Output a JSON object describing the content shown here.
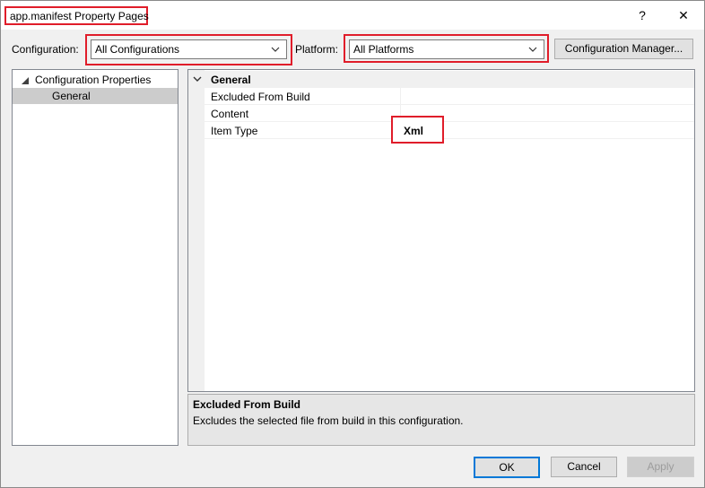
{
  "window": {
    "title": "app.manifest Property Pages",
    "help_glyph": "?",
    "close_glyph": "✕"
  },
  "toolbar": {
    "configuration_label": "Configuration:",
    "configuration_value": "All Configurations",
    "platform_label": "Platform:",
    "platform_value": "All Platforms",
    "config_manager_label": "Configuration Manager..."
  },
  "tree": {
    "root_label": "Configuration Properties",
    "child_label": "General"
  },
  "grid": {
    "section_title": "General",
    "rows": [
      {
        "name": "Excluded From Build",
        "value": ""
      },
      {
        "name": "Content",
        "value": ""
      },
      {
        "name": "Item Type",
        "value": "Xml"
      }
    ]
  },
  "description": {
    "title": "Excluded From Build",
    "text": "Excludes the selected file from build in this configuration."
  },
  "footer": {
    "ok_label": "OK",
    "cancel_label": "Cancel",
    "apply_label": "Apply"
  },
  "colors": {
    "highlight_outline": "#e01d2a",
    "selection": "#cce4f7",
    "focus_border": "#0078d7"
  },
  "icons": {
    "dropdown": "chevron-down-icon",
    "tree_expand": "triangle-expanded-icon",
    "section_collapse": "chevron-down-icon"
  }
}
